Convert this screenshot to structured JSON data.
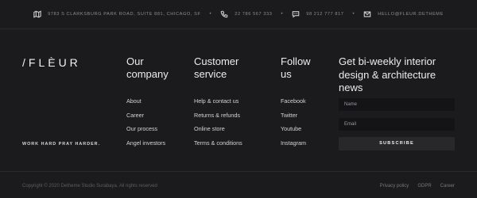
{
  "contact": {
    "address": "9783 S CLARKSBURG PARK ROAD, SUITE 881, CHICAGO, SF",
    "phone": "22 786 567 333",
    "chat": "98 212 777 817",
    "email": "HELLO@FLEUR.DETHEME",
    "icons": [
      "map-icon",
      "phone-icon",
      "chat-icon",
      "mail-icon"
    ]
  },
  "brand": {
    "logo": "/FLÈUR",
    "tagline": "WORK HARD PRAY HARDER."
  },
  "columns": [
    {
      "title_line1": "Our",
      "title_line2": "company",
      "links": [
        "About",
        "Career",
        "Our process",
        "Angel investors"
      ]
    },
    {
      "title_line1": "Customer",
      "title_line2": "service",
      "links": [
        "Help & contact us",
        "Returns & refunds",
        "Online store",
        "Terms & conditions"
      ]
    },
    {
      "title_line1": "Follow",
      "title_line2": "us",
      "links": [
        "Facebook",
        "Twitter",
        "Youtube",
        "Instagram"
      ]
    }
  ],
  "newsletter": {
    "title_line1": "Get bi-weekly interior",
    "title_line2": "design & architecture news",
    "name_placeholder": "Name",
    "email_placeholder": "Email",
    "subscribe_label": "SUBSCRIBE"
  },
  "footer": {
    "copyright": "Copyright © 2020 Detheme Studio Surabaya. All rights reserved",
    "links": [
      "Privacy policy",
      "GDPR",
      "Career"
    ]
  },
  "colors": {
    "background": "#1b1b1d",
    "divider": "#2a2a2d",
    "button": "#28282b"
  }
}
